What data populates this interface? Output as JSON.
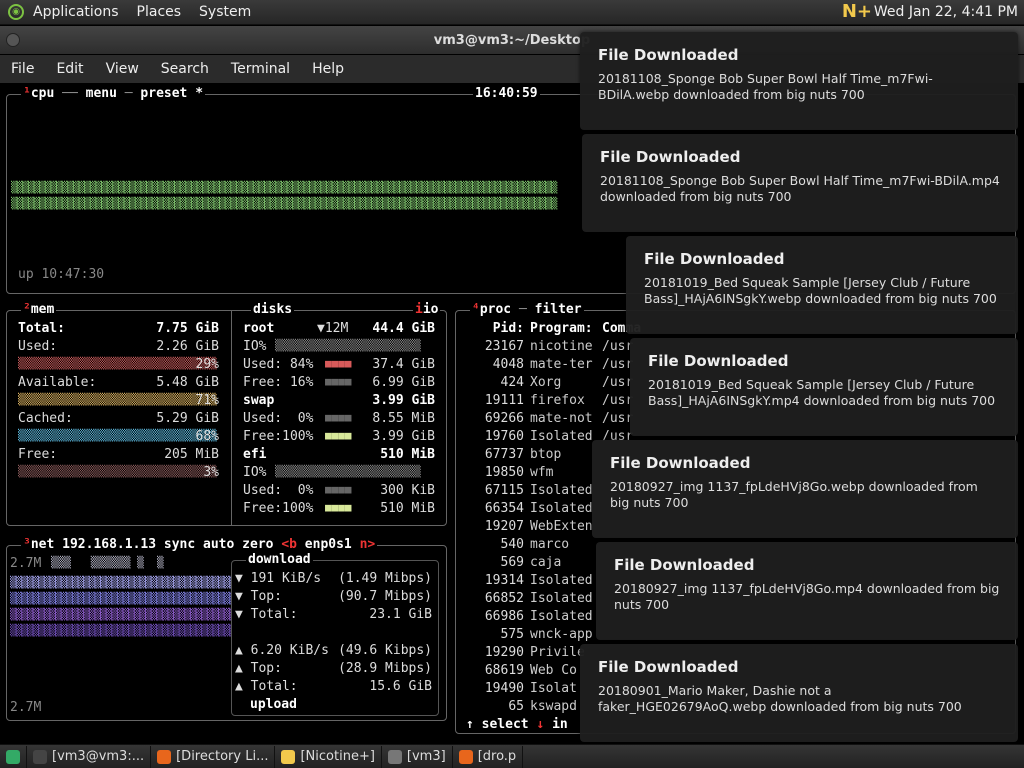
{
  "panel": {
    "menus": [
      "Applications",
      "Places",
      "System"
    ],
    "clock": "Wed Jan 22,  4:41 PM"
  },
  "window": {
    "title": "vm3@vm3:~/Desktop",
    "menus": [
      "File",
      "Edit",
      "View",
      "Search",
      "Terminal",
      "Help"
    ]
  },
  "cpu": {
    "t1": "cpu",
    "t2": "menu",
    "t3": "preset",
    "t4": "*",
    "time": "16:40:59",
    "uptime": "up 10:47:30"
  },
  "mem": {
    "title": "mem",
    "total_l": "Total:",
    "total_v": "7.75 GiB",
    "used_l": "Used:",
    "used_v": "2.26 GiB",
    "used_p": "29%",
    "avail_l": "Available:",
    "avail_v": "5.48 GiB",
    "avail_p": "71%",
    "cached_l": "Cached:",
    "cached_v": "5.29 GiB",
    "cached_p": "68%",
    "free_l": "Free:",
    "free_v": "205 MiB",
    "free_p": "3%"
  },
  "disks": {
    "title": "disks",
    "io": "io",
    "root": "root",
    "root_io": "▼12M",
    "root_sz": "44.4 GiB",
    "root_used": "Used: 84%",
    "root_used_v": "37.4 GiB",
    "root_free": "Free: 16%",
    "root_free_v": "6.99 GiB",
    "swap": "swap",
    "swap_sz": "3.99 GiB",
    "swap_used": "Used:  0%",
    "swap_used_v": "8.55 MiB",
    "swap_free": "Free:100%",
    "swap_free_v": "3.99 GiB",
    "efi": "efi",
    "efi_sz": "510 MiB",
    "efi_used": "Used:  0%",
    "efi_used_v": "300 KiB",
    "efi_free": "Free:100%",
    "efi_free_v": "510 MiB",
    "io_lbl": "IO%"
  },
  "net": {
    "title": "net",
    "ip": "192.168.1.13",
    "sync": "sync",
    "auto": "auto",
    "zero": "zero",
    "b": "<b",
    "iface": "enp0s1",
    "n": "n>",
    "scale_top": "2.7M",
    "scale_bot": "2.7M",
    "dl": "download",
    "dl_rate": "191 KiB/s",
    "dl_mbps": "(1.49 Mibps)",
    "top": "Top:",
    "dl_top": "(90.7 Mibps)",
    "total": "Total:",
    "dl_total": "23.1 GiB",
    "ul_rate": "6.20 KiB/s",
    "ul_mbps": "(49.6 Kibps)",
    "ul_top": "(28.9 Mibps)",
    "ul_total": "15.6 GiB",
    "ul": "upload"
  },
  "proc": {
    "title": "proc",
    "filter": "filter",
    "h_pid": "Pid:",
    "h_prog": "Program:",
    "h_cmd": "Comma",
    "rows": [
      [
        "23167",
        "nicotine"
      ],
      [
        "4048",
        "mate-ter"
      ],
      [
        "424",
        "Xorg"
      ],
      [
        "19111",
        "firefox"
      ],
      [
        "69266",
        "mate-not"
      ],
      [
        "19760",
        "Isolated"
      ],
      [
        "67737",
        "btop"
      ],
      [
        "19850",
        "wfm"
      ],
      [
        "67115",
        "Isolated"
      ],
      [
        "66354",
        "Isolated"
      ],
      [
        "19207",
        "WebExten"
      ],
      [
        "540",
        "marco"
      ],
      [
        "569",
        "caja"
      ],
      [
        "19314",
        "Isolated"
      ],
      [
        "66852",
        "Isolated"
      ],
      [
        "66986",
        "Isolated"
      ],
      [
        "575",
        "wnck-app"
      ],
      [
        "19290",
        "Privile"
      ],
      [
        "68619",
        "Web Co"
      ],
      [
        "19490",
        "Isolat"
      ],
      [
        "65",
        "kswapd"
      ]
    ],
    "cmds": [
      "/usr",
      "/usr",
      "/usr",
      "/usr",
      "/usr",
      "/usr"
    ],
    "select": "select",
    "info": "in"
  },
  "notifications": [
    {
      "title": "File Downloaded",
      "msg": "20181108_Sponge Bob Super Bowl Half Time_m7Fwi-BDilA.webp downloaded from big nuts 700"
    },
    {
      "title": "File Downloaded",
      "msg": "20181108_Sponge Bob Super Bowl Half Time_m7Fwi-BDilA.mp4 downloaded from big nuts 700"
    },
    {
      "title": "File Downloaded",
      "msg": "20181019_Bed Squeak Sample [Jersey Club / Future Bass]_HAjA6INSgkY.webp downloaded from big nuts 700"
    },
    {
      "title": "File Downloaded",
      "msg": "20181019_Bed Squeak Sample [Jersey Club / Future Bass]_HAjA6INSgkY.mp4 downloaded from big nuts 700"
    },
    {
      "title": "File Downloaded",
      "msg": "20180927_img 1137_fpLdeHVj8Go.webp downloaded from big nuts 700"
    },
    {
      "title": "File Downloaded",
      "msg": "20180927_img 1137_fpLdeHVj8Go.mp4 downloaded from big nuts 700"
    },
    {
      "title": "File Downloaded",
      "msg": "20180901_Mario Maker, Dashie not a faker_HGE02679AoQ.webp downloaded from big nuts 700"
    }
  ],
  "taskbar": [
    {
      "label": "[vm3@vm3:...",
      "color": "#444444"
    },
    {
      "label": "[Directory Li...",
      "color": "#e8661c"
    },
    {
      "label": "[Nicotine+]",
      "color": "#f2c94c"
    },
    {
      "label": "[vm3]",
      "color": "#777777"
    },
    {
      "label": "[dro.p",
      "color": "#e8661c"
    }
  ]
}
